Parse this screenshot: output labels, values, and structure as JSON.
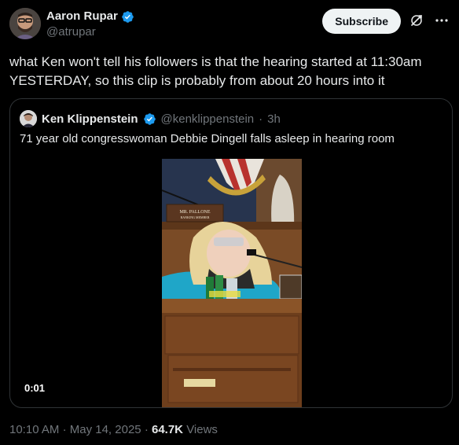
{
  "author": {
    "display_name": "Aaron Rupar",
    "handle": "@atrupar",
    "verified_icon": "verified-badge-icon",
    "avatar_icon": "avatar"
  },
  "header_actions": {
    "subscribe_label": "Subscribe",
    "grok_icon": "grok-icon",
    "more_icon": "more-icon"
  },
  "tweet": {
    "text": "what Ken won't tell his followers is that the hearing started at 11:30am YESTERDAY, so this clip is probably from about 20 hours into it"
  },
  "quoted": {
    "display_name": "Ken Klippenstein",
    "handle": "@kenklippenstein",
    "separator": "·",
    "time": "3h",
    "text": "71 year old congresswoman Debbie Dingell falls asleep in hearing room",
    "video": {
      "duration": "0:01",
      "placard_line1": "MR. PALLONE",
      "placard_line2": "RANKING MEMBER"
    }
  },
  "meta": {
    "time": "10:10 AM",
    "sep1": "·",
    "date": "May 14, 2025",
    "sep2": "·",
    "views_count": "64.7K",
    "views_label": "Views"
  },
  "colors": {
    "background": "#000000",
    "text_primary": "#e7e9ea",
    "text_secondary": "#71767b",
    "border": "#2f3336",
    "verified": "#1d9bf0",
    "subscribe_bg": "#eff3f4"
  }
}
